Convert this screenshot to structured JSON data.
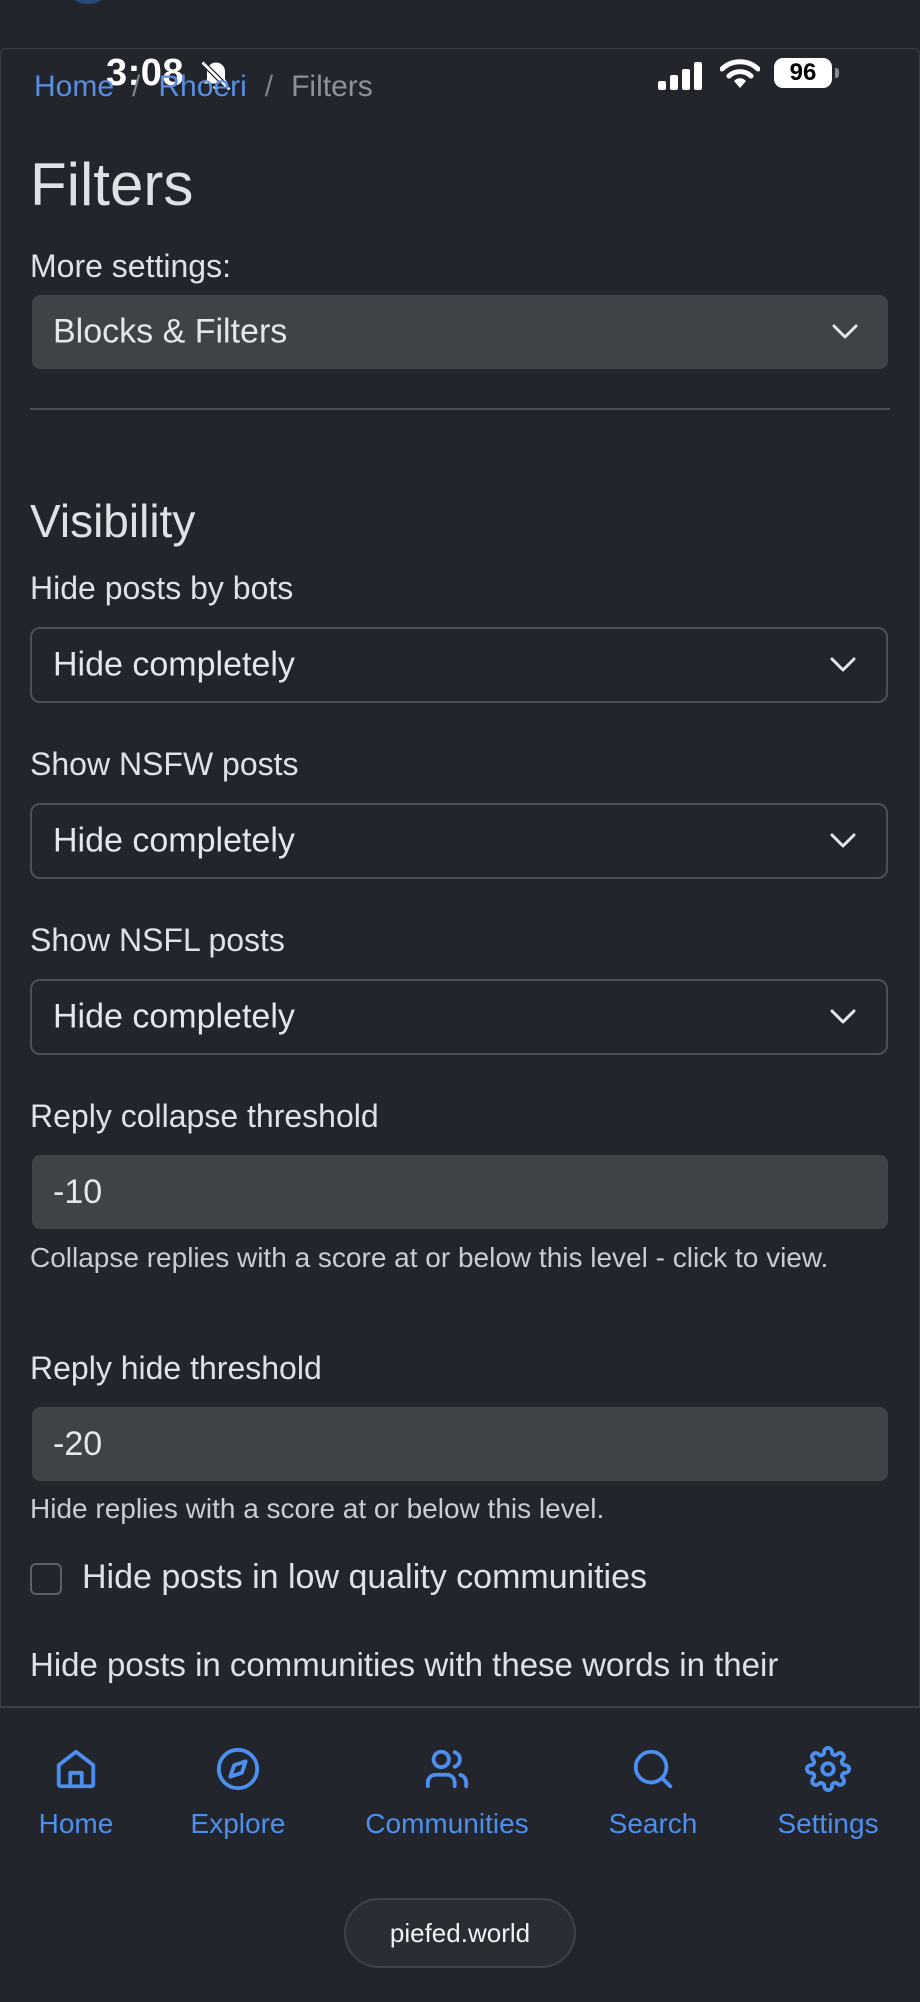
{
  "status_bar": {
    "time": "3:08",
    "battery": "96"
  },
  "breadcrumb": {
    "home": "Home",
    "user": "Rhoeri",
    "current": "Filters"
  },
  "page": {
    "title": "Filters"
  },
  "more_settings": {
    "label": "More settings:",
    "selected": "Blocks & Filters"
  },
  "visibility": {
    "title": "Visibility",
    "bots": {
      "label": "Hide posts by bots",
      "selected": "Hide completely"
    },
    "nsfw": {
      "label": "Show NSFW posts",
      "selected": "Hide completely"
    },
    "nsfl": {
      "label": "Show NSFL posts",
      "selected": "Hide completely"
    },
    "collapse": {
      "label": "Reply collapse threshold",
      "value": "-10",
      "help": "Collapse replies with a score at or below this level - click to view."
    },
    "hide": {
      "label": "Reply hide threshold",
      "value": "-20",
      "help": "Hide replies with a score at or below this level."
    },
    "low_quality": {
      "label": "Hide posts in low quality communities",
      "checked": false
    },
    "words_label": "Hide posts in communities with these words in their"
  },
  "bottom_nav": {
    "items": [
      {
        "label": "Home",
        "icon": "home-icon"
      },
      {
        "label": "Explore",
        "icon": "compass-icon"
      },
      {
        "label": "Communities",
        "icon": "users-icon"
      },
      {
        "label": "Search",
        "icon": "search-icon"
      },
      {
        "label": "Settings",
        "icon": "gear-icon"
      }
    ],
    "accent": "#4d8ff0"
  },
  "site": "piefed.world"
}
